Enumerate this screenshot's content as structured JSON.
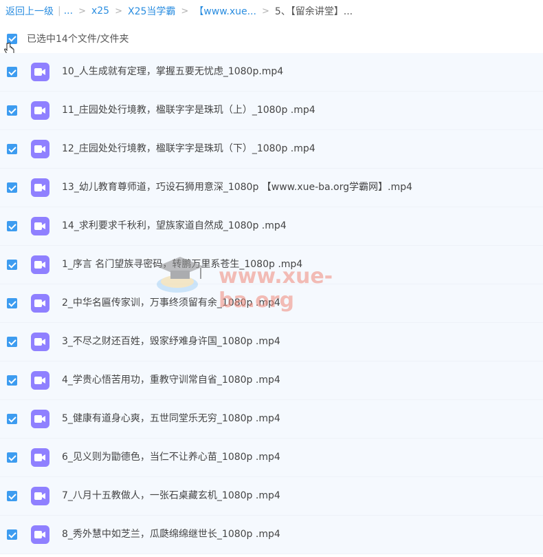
{
  "breadcrumb": {
    "back": "返回上一级",
    "pipe": "|",
    "ellipsis": "...",
    "sep": ">",
    "items": [
      "x25",
      "X25当学霸",
      "【www.xue..."
    ],
    "current": "5、【留余讲堂】..."
  },
  "selection": {
    "label": "已选中14个文件/文件夹",
    "checked": true
  },
  "files": [
    {
      "name": "10_人生成就有定理，掌握五要无忧虑_1080p.mp4",
      "checked": true,
      "icon": "video-icon"
    },
    {
      "name": "11_庄园处处行境教，楹联字字是珠玑（上）_1080p .mp4",
      "checked": true,
      "icon": "video-icon"
    },
    {
      "name": "12_庄园处处行境教，楹联字字是珠玑（下）_1080p .mp4",
      "checked": true,
      "icon": "video-icon"
    },
    {
      "name": "13_幼儿教育尊师道，巧设石狮用意深_1080p 【www.xue-ba.org学霸网】.mp4",
      "checked": true,
      "icon": "video-icon"
    },
    {
      "name": "14_求利要求千秋利，望族家道自然成_1080p .mp4",
      "checked": true,
      "icon": "video-icon"
    },
    {
      "name": "1_序言 名门望族寻密码，转鹏万里系苍生_1080p .mp4",
      "checked": true,
      "icon": "video-icon"
    },
    {
      "name": "2_中华名匾传家训，万事终须留有余_1080p .mp4",
      "checked": true,
      "icon": "video-icon"
    },
    {
      "name": "3_不尽之财还百姓，毁家纾难身许国_1080p .mp4",
      "checked": true,
      "icon": "video-icon"
    },
    {
      "name": "4_学贵心悟苦用功，重教守训常自省_1080p .mp4",
      "checked": true,
      "icon": "video-icon"
    },
    {
      "name": "5_健康有道身心爽，五世同堂乐无穷_1080p .mp4",
      "checked": true,
      "icon": "video-icon"
    },
    {
      "name": "6_见义则为勖德色，当仁不让养心苗_1080p .mp4",
      "checked": true,
      "icon": "video-icon"
    },
    {
      "name": "7_八月十五教做人，一张石桌藏玄机_1080p .mp4",
      "checked": true,
      "icon": "video-icon"
    },
    {
      "name": "8_秀外慧中如芝兰，瓜瓞绵绵继世长_1080p .mp4",
      "checked": true,
      "icon": "video-icon"
    }
  ],
  "watermark": {
    "text": "www.xue-ba.org"
  },
  "colors": {
    "link": "#2a8de0",
    "checkbox": "#3d9cf0",
    "video_icon": "#8f80ff",
    "row_bg": "#f5f9fe"
  }
}
